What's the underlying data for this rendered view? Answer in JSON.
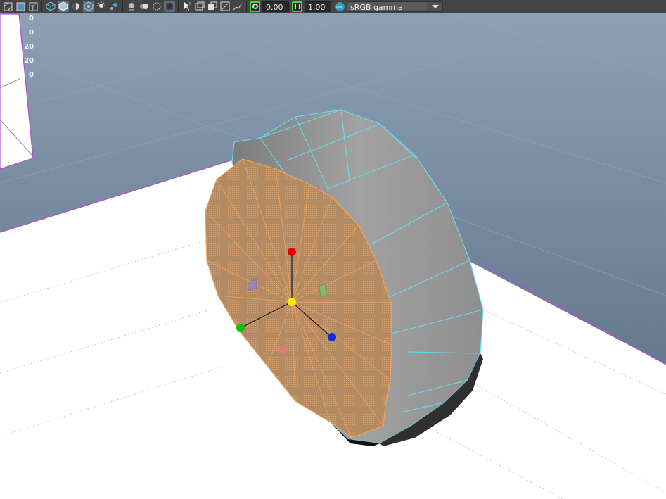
{
  "toolbar": {
    "icons": [
      "wireframe-icon",
      "shaded-icon",
      "texture-icon",
      "cube-wireframe-icon",
      "cube-shaded-icon",
      "half-shade-icon",
      "xray-icon",
      "light-bulb-icon",
      "lights-icon",
      "sphere-icon",
      "ambient-occlusion-icon",
      "motion-blur-icon",
      "isolate-icon",
      "select-pointer-icon",
      "camera-pick-icon",
      "resolution-gate-icon",
      "gate-mask-icon",
      "field-chart-icon"
    ],
    "exposure_value": "0.00",
    "gamma_value": "1.00",
    "color_management_badge": "ON",
    "color_space": "sRGB gamma"
  },
  "hud": {
    "values": [
      "0",
      "0",
      "20",
      "20",
      "0"
    ]
  },
  "scene": {
    "background_top": "#8a9db3",
    "background_bottom": "#5f7287",
    "ground_color": "#ffffff",
    "wire_color": "#5de3f5",
    "selection_color": "#f0a35e",
    "highlight_edge": "#b04fd1"
  }
}
